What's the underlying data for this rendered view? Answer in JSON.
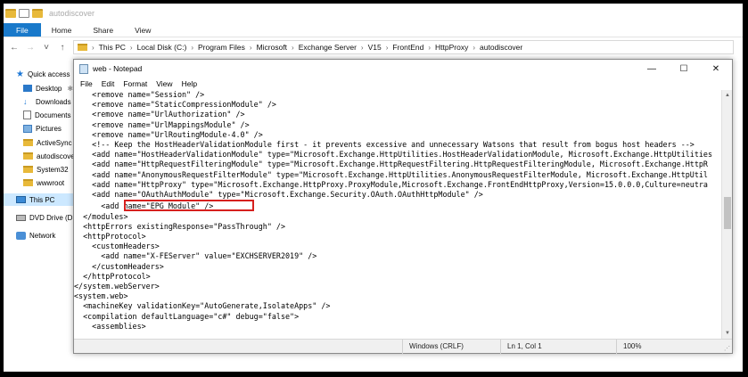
{
  "explorer": {
    "title": "autodiscover",
    "ribbon_tabs": [
      "File",
      "Home",
      "Share",
      "View"
    ],
    "breadcrumb": [
      "This PC",
      "Local Disk (C:)",
      "Program Files",
      "Microsoft",
      "Exchange Server",
      "V15",
      "FrontEnd",
      "HttpProxy",
      "autodiscover"
    ]
  },
  "nav_pane": {
    "items": [
      {
        "label": "Quick access",
        "icon": "star-icon"
      },
      {
        "label": "Desktop",
        "icon": "desktop-icon"
      },
      {
        "label": "Downloads",
        "icon": "download-icon"
      },
      {
        "label": "Documents",
        "icon": "documents-icon"
      },
      {
        "label": "Pictures",
        "icon": "pictures-icon"
      },
      {
        "label": "ActiveSync",
        "icon": "folder-icon"
      },
      {
        "label": "autodiscover",
        "icon": "folder-icon"
      },
      {
        "label": "System32",
        "icon": "folder-icon"
      },
      {
        "label": "wwwroot",
        "icon": "folder-icon"
      },
      {
        "label": "This PC",
        "icon": "computer-icon"
      },
      {
        "label": "DVD Drive (D:)",
        "icon": "dvd-icon"
      },
      {
        "label": "Network",
        "icon": "network-icon"
      }
    ]
  },
  "notepad": {
    "title": "web - Notepad",
    "menu": [
      "File",
      "Edit",
      "Format",
      "View",
      "Help"
    ],
    "controls": {
      "minimize": "—",
      "maximize": "☐",
      "close": "✕"
    },
    "lines": [
      "    <remove name=\"Session\" />",
      "    <remove name=\"StaticCompressionModule\" />",
      "    <remove name=\"UrlAuthorization\" />",
      "    <remove name=\"UrlMappingsModule\" />",
      "    <remove name=\"UrlRoutingModule-4.0\" />",
      "    <!-- Keep the HostHeaderValidationModule first - it prevents excessive and unnecessary Watsons that result from bogus host headers -->",
      "    <add name=\"HostHeaderValidationModule\" type=\"Microsoft.Exchange.HttpUtilities.HostHeaderValidationModule, Microsoft.Exchange.HttpUtilities",
      "    <add name=\"HttpRequestFilteringModule\" type=\"Microsoft.Exchange.HttpRequestFiltering.HttpRequestFilteringModule, Microsoft.Exchange.HttpR",
      "    <add name=\"AnonymousRequestFilterModule\" type=\"Microsoft.Exchange.HttpUtilities.AnonymousRequestFilterModule, Microsoft.Exchange.HttpUtil",
      "    <add name=\"HttpProxy\" type=\"Microsoft.Exchange.HttpProxy.ProxyModule,Microsoft.Exchange.FrontEndHttpProxy,Version=15.0.0.0,Culture=neutra",
      "    <add name=\"OAuthAuthModule\" type=\"Microsoft.Exchange.Security.OAuth.OAuthHttpModule\" />",
      "      <add name=\"EPG Module\" />",
      "  </modules>",
      "  <httpErrors existingResponse=\"PassThrough\" />",
      "  <httpProtocol>",
      "    <customHeaders>",
      "      <add name=\"X-FEServer\" value=\"EXCHSERVER2019\" />",
      "    </customHeaders>",
      "  </httpProtocol>",
      "</system.webServer>",
      "<system.web>",
      "  <machineKey validationKey=\"AutoGenerate,IsolateApps\" />",
      "  <compilation defaultLanguage=\"c#\" debug=\"false\">",
      "    <assemblies>"
    ],
    "status": {
      "encoding": "Windows (CRLF)",
      "position": "Ln 1, Col 1",
      "zoom": "100%"
    }
  },
  "colors": {
    "highlight_border": "#d6201e",
    "ribbon_file": "#1979ca",
    "selection": "#cce8ff"
  }
}
